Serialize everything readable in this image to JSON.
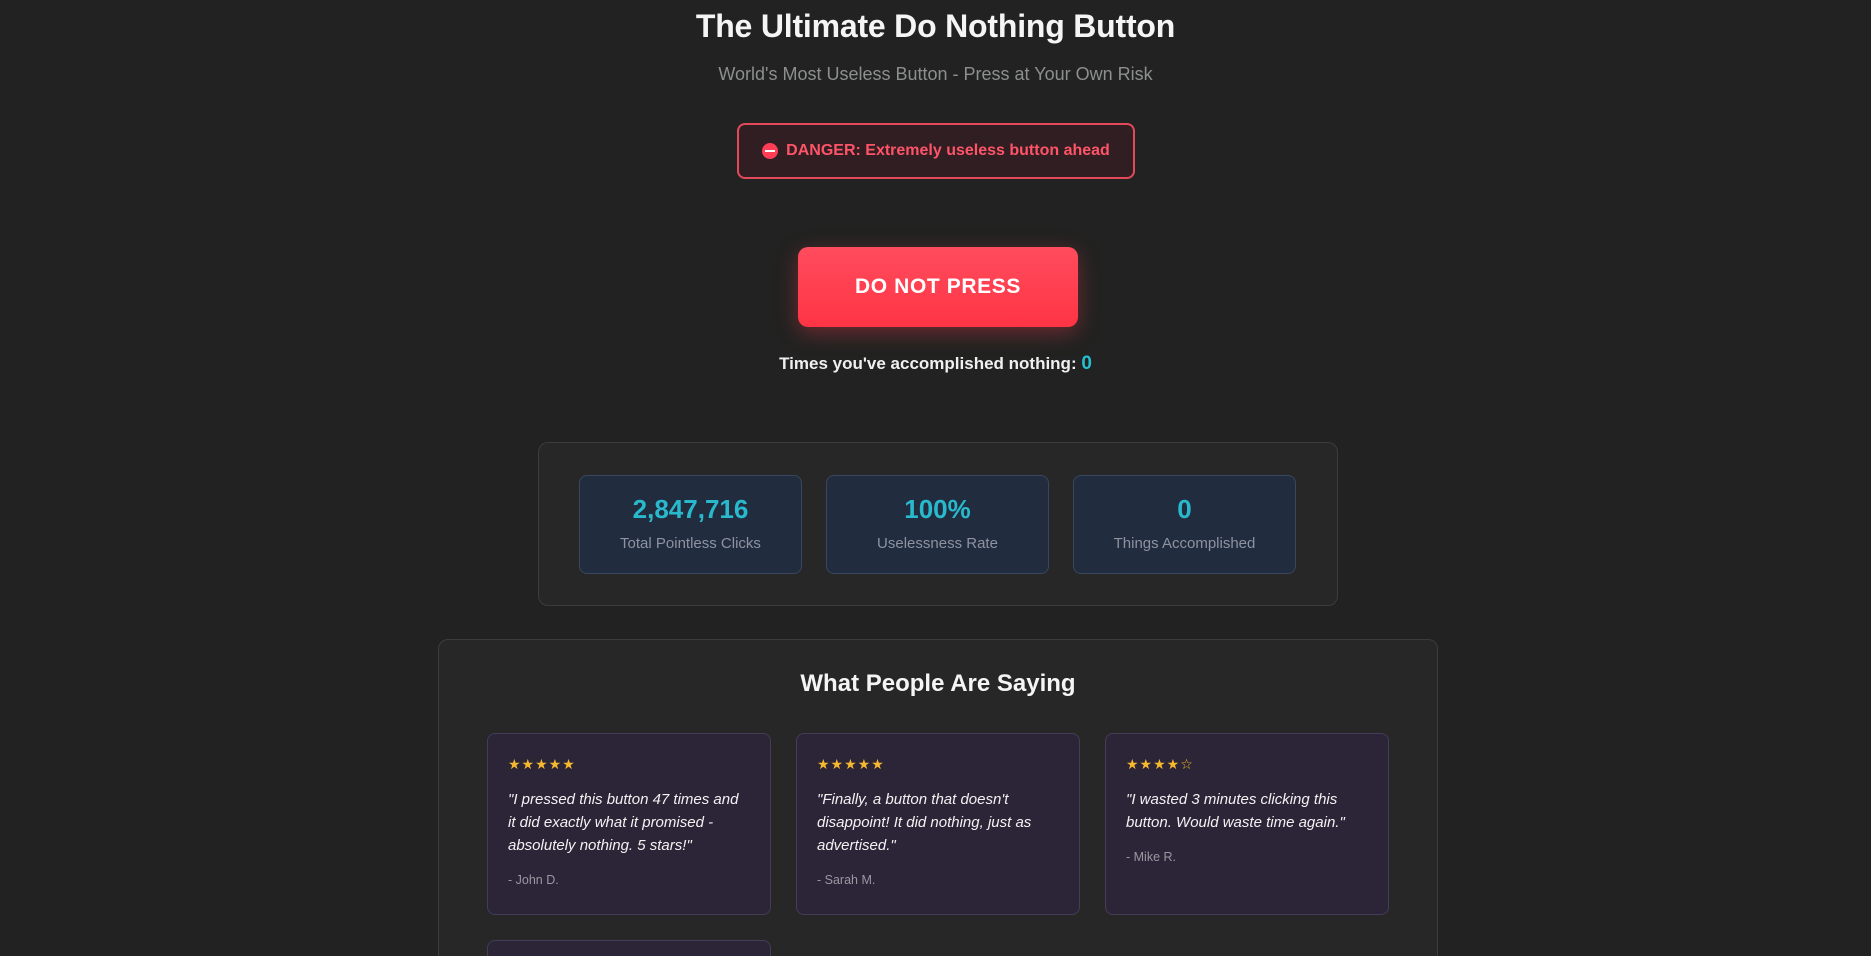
{
  "header": {
    "title": "The Ultimate Do Nothing Button",
    "subtitle": "World's Most Useless Button - Press at Your Own Risk"
  },
  "warning": {
    "icon": "no-entry-icon",
    "text": "DANGER: Extremely useless button ahead"
  },
  "main_button": {
    "label": "DO NOT PRESS"
  },
  "counter": {
    "label": "Times you've accomplished nothing: ",
    "value": "0"
  },
  "stats": [
    {
      "value": "2,847,716",
      "label": "Total Pointless Clicks"
    },
    {
      "value": "100%",
      "label": "Uselessness Rate"
    },
    {
      "value": "0",
      "label": "Things Accomplished"
    }
  ],
  "reviews": {
    "title": "What People Are Saying",
    "items": [
      {
        "stars": "★★★★★",
        "rating": 5,
        "quote": "\"I pressed this button 47 times and it did exactly what it promised - absolutely nothing. 5 stars!\"",
        "author": "- John D."
      },
      {
        "stars": "★★★★★",
        "rating": 5,
        "quote": "\"Finally, a button that doesn't disappoint! It did nothing, just as advertised.\"",
        "author": "- Sarah M."
      },
      {
        "stars": "★★★★☆",
        "rating": 4,
        "quote": "\"I wasted 3 minutes clicking this button. Would waste time again.\"",
        "author": "- Mike R."
      }
    ]
  },
  "colors": {
    "background": "#212221",
    "accent_red": "#ff3d50",
    "accent_cyan": "#29b9cc",
    "star_gold": "#f5b82e"
  }
}
